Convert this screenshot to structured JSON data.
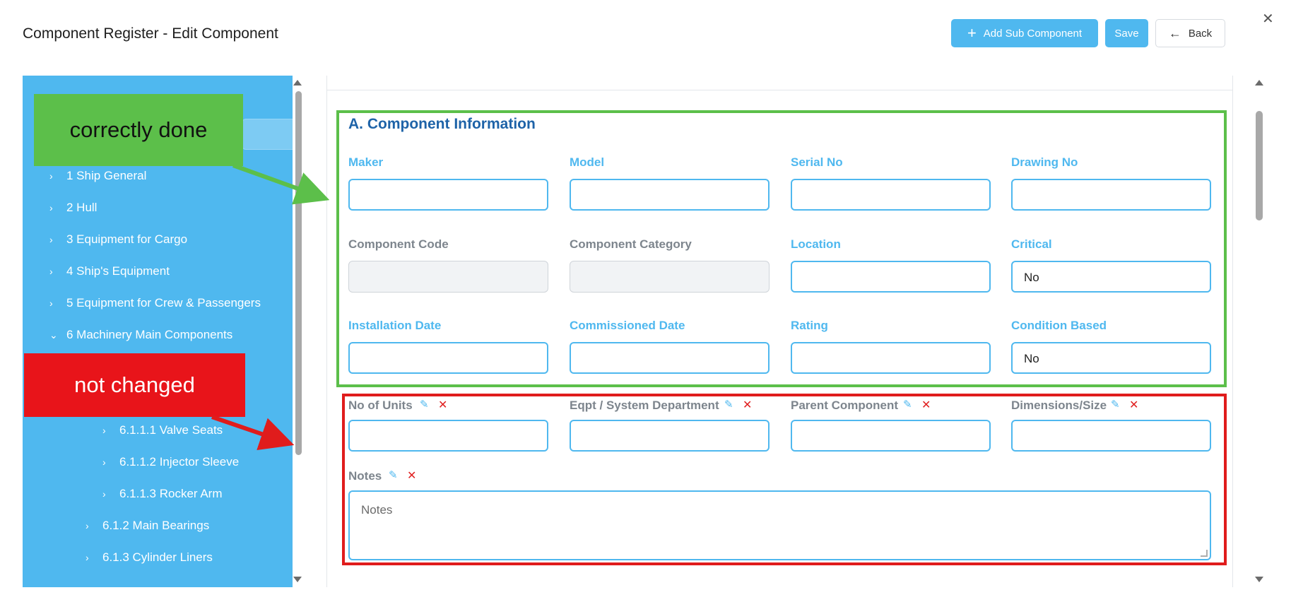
{
  "header": {
    "title": "Component Register - Edit Component",
    "add_sub_label": "Add Sub Component",
    "save_label": "Save",
    "back_label": "Back",
    "accent_color": "#4fb8ef"
  },
  "tree": {
    "items": [
      {
        "label": "1 Ship General",
        "chevron": "›"
      },
      {
        "label": "2 Hull",
        "chevron": "›"
      },
      {
        "label": "3 Equipment for Cargo",
        "chevron": "›"
      },
      {
        "label": "4 Ship's Equipment",
        "chevron": "›"
      },
      {
        "label": "5 Equipment for Crew & Passengers",
        "chevron": "›"
      },
      {
        "label": "6 Machinery Main Components",
        "chevron": "⌄"
      },
      {
        "label": "6.1.1.1 Valve Seats",
        "chevron": "›"
      },
      {
        "label": "6.1.1.2 Injector Sleeve",
        "chevron": "›"
      },
      {
        "label": "6.1.1.3 Rocker Arm",
        "chevron": "›"
      },
      {
        "label": "6.1.2 Main Bearings",
        "chevron": "›"
      },
      {
        "label": "6.1.3 Cylinder Liners",
        "chevron": "›"
      }
    ],
    "background": "#4fb8ef"
  },
  "form": {
    "section_title": "A. Component Information",
    "fields": {
      "maker": {
        "label": "Maker",
        "value": ""
      },
      "model": {
        "label": "Model",
        "value": ""
      },
      "serial_no": {
        "label": "Serial No",
        "value": ""
      },
      "drawing_no": {
        "label": "Drawing No",
        "value": ""
      },
      "component_code": {
        "label": "Component Code",
        "value": ""
      },
      "component_category": {
        "label": "Component Category",
        "value": ""
      },
      "location": {
        "label": "Location",
        "value": ""
      },
      "critical": {
        "label": "Critical",
        "value": "No"
      },
      "installation_date": {
        "label": "Installation Date",
        "value": ""
      },
      "commissioned_date": {
        "label": "Commissioned Date",
        "value": ""
      },
      "rating": {
        "label": "Rating",
        "value": ""
      },
      "condition_based": {
        "label": "Condition Based",
        "value": "No"
      },
      "no_of_units": {
        "label": "No of Units",
        "value": ""
      },
      "eqpt_department": {
        "label": "Eqpt / System Department",
        "value": ""
      },
      "parent_component": {
        "label": "Parent Component",
        "value": ""
      },
      "dimensions_size": {
        "label": "Dimensions/Size",
        "value": ""
      },
      "notes": {
        "label": "Notes",
        "placeholder": "Notes"
      }
    },
    "edit_glyph": "✎",
    "delete_glyph": "✕"
  },
  "annotations": {
    "correct_label": "correctly done",
    "correct_color": "#5cbf4a",
    "not_changed_label": "not changed",
    "not_changed_color": "#e8141a"
  }
}
